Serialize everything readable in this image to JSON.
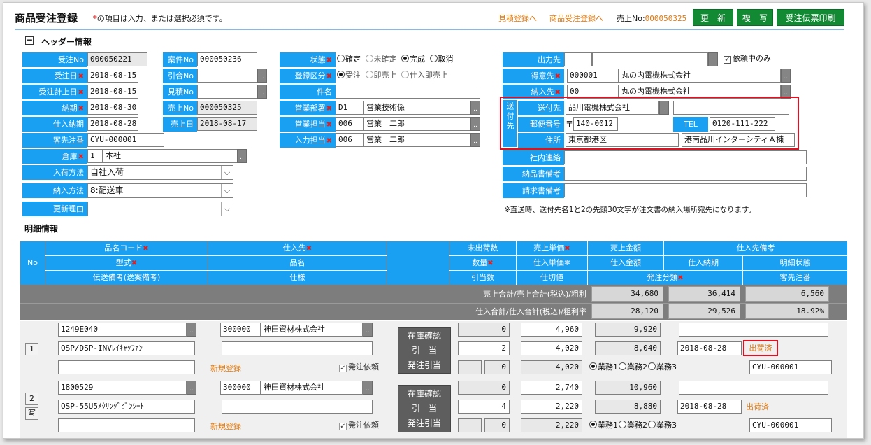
{
  "page": {
    "title": "商品受注登録",
    "required_note_mark": "*",
    "required_note": "の項目は入力、または選択必須です。"
  },
  "top": {
    "link1": "見積登録へ",
    "link2": "商品受注登録へ",
    "sales_no_label": "売上No:",
    "sales_no": "000050325",
    "btn_update": "更　新",
    "btn_copy": "複　写",
    "btn_print": "受注伝票印刷"
  },
  "header_section": {
    "toggle": "−",
    "title": "ヘッダー情報"
  },
  "h": {
    "order_no": {
      "label": "受注No",
      "value": "000050221"
    },
    "case_no": {
      "label": "案件No",
      "value": "000050236"
    },
    "status": {
      "label": "状態",
      "options": [
        "確定",
        "未確定",
        "完成",
        "取消"
      ]
    },
    "order_date": {
      "label": "受注日",
      "value": "2018-08-15"
    },
    "ref_no": {
      "label": "引合No",
      "value": ""
    },
    "reg_type": {
      "label": "登録区分",
      "options": [
        "受注",
        "即売上",
        "仕入即売上"
      ]
    },
    "book_date": {
      "label": "受注計上日",
      "value": "2018-08-15"
    },
    "est_no": {
      "label": "見積No",
      "value": ""
    },
    "subject": {
      "label": "件名",
      "value": ""
    },
    "due": {
      "label": "納期",
      "value": "2018-08-30"
    },
    "sale_no": {
      "label": "売上No",
      "value": "000050325"
    },
    "dept": {
      "label": "営業部署",
      "code": "D1",
      "name": "営業技術係"
    },
    "pur_due": {
      "label": "仕入納期",
      "value": "2018-08-28"
    },
    "sale_date": {
      "label": "売上日",
      "value": "2018-08-17"
    },
    "staff": {
      "label": "営業担当",
      "code": "006",
      "name": "営業　二郎"
    },
    "cust_order": {
      "label": "客先注番",
      "value": "CYU-000001"
    },
    "input_staff": {
      "label": "入力担当",
      "code": "006",
      "name": "営業　二郎"
    },
    "warehouse": {
      "label": "倉庫",
      "code": "1",
      "name": "本社"
    },
    "arrival": {
      "label": "入荷方法",
      "value": "自社入荷"
    },
    "delivery": {
      "label": "納入方法",
      "value": "8:配送車"
    },
    "reason": {
      "label": "更新理由",
      "value": ""
    },
    "output": {
      "label": "出力先",
      "code": "",
      "name": "",
      "check": "依頼中のみ"
    },
    "customer": {
      "label": "得意先",
      "code": "000001",
      "name": "丸の内電機株式会社"
    },
    "ship_to": {
      "label": "納入先",
      "code": "00",
      "name": "丸の内電機株式会社"
    },
    "sendto": {
      "group_label": "送付先",
      "dest_label": "送付先",
      "dest": "品川電機株式会社",
      "dest2": "",
      "zip_label": "郵便番号",
      "zip_mark": "〒",
      "zip": "140-0012",
      "tel_label": "TEL",
      "tel": "0120-111-222",
      "addr_label": "住所",
      "addr1": "東京都港区",
      "addr2": "港南品川インターシティＡ棟"
    },
    "internal": {
      "label": "社内連絡",
      "value": ""
    },
    "deliv_note": {
      "label": "納品書備考",
      "value": ""
    },
    "bill_note": {
      "label": "請求書備考",
      "value": ""
    },
    "note": "※直送時、送付先名1と2の先頭30文字が注文書の納入場所宛先になります。"
  },
  "detail_title": "明細情報",
  "cols": {
    "no": "No",
    "c1a": "品名コード",
    "c1b": "型式",
    "c1c": "伝送備考(送案備考)",
    "c2a": "仕入先",
    "c2b": "品名",
    "c2c": "仕様",
    "c4a": "未出荷数",
    "c4b": "数量",
    "c4c": "引当数",
    "c5a": "売上単価",
    "c5b": "仕入単価",
    "c5c": "仕切値",
    "c6a": "売上金額",
    "c6b": "仕入金額",
    "c6c": "発注分類",
    "c7a": "仕入先備考",
    "c7b": "仕入納期",
    "c7c": "客先注番",
    "c8b": "明細状態"
  },
  "totals": {
    "sales_label": "売上合計/売上合計(税込)/粗利",
    "sales": "34,680",
    "sales_tax": "36,414",
    "profit": "6,560",
    "pur_label": "仕入合計/仕入合計(税込)/粗利率",
    "pur": "28,120",
    "pur_tax": "29,526",
    "rate": "18.92%"
  },
  "rows": [
    {
      "no": "1",
      "code": "1249E040",
      "model": "OSP/DSP-INVﾚｲｷｬｸﾌｧﾝ",
      "memo": "",
      "sup_code": "300000",
      "sup_name": "神田資材株式会社",
      "name": "",
      "spec": "",
      "new": "新規登録",
      "order_req": "発注依頼",
      "ctrl1": "在庫確認",
      "ctrl2": "引　当",
      "ctrl3": "発注引当",
      "unshipped": "0",
      "qty": "2",
      "alloc1": "",
      "alloc2": "0",
      "s_price": "4,960",
      "p_price": "4,020",
      "cut": "4,020",
      "s_amt": "9,920",
      "p_amt": "8,040",
      "sup_memo": "",
      "p_due": "2018-08-28",
      "state": "出荷済",
      "types": [
        "業務1",
        "業務2",
        "業務3"
      ],
      "cust_no": "CYU-000001"
    },
    {
      "no": "2",
      "copy": "写",
      "code": "1800529",
      "model": "OSP-55U5ﾒｸﾘﾝｸﾞﾋﾟﾝｼｰﾄ",
      "memo": "",
      "sup_code": "300000",
      "sup_name": "神田資材株式会社",
      "name": "",
      "spec": "",
      "new": "新規登録",
      "order_req": "発注依頼",
      "ctrl1": "在庫確認",
      "ctrl2": "引　当",
      "ctrl3": "発注引当",
      "unshipped": "0",
      "qty": "4",
      "alloc1": "",
      "alloc2": "0",
      "s_price": "2,740",
      "p_price": "2,220",
      "cut": "2,220",
      "s_amt": "10,960",
      "p_amt": "8,880",
      "sup_memo": "",
      "p_due": "2018-08-28",
      "state": "出荷済",
      "types": [
        "業務1",
        "業務2",
        "業務3"
      ],
      "cust_no": "CYU-000001"
    }
  ]
}
